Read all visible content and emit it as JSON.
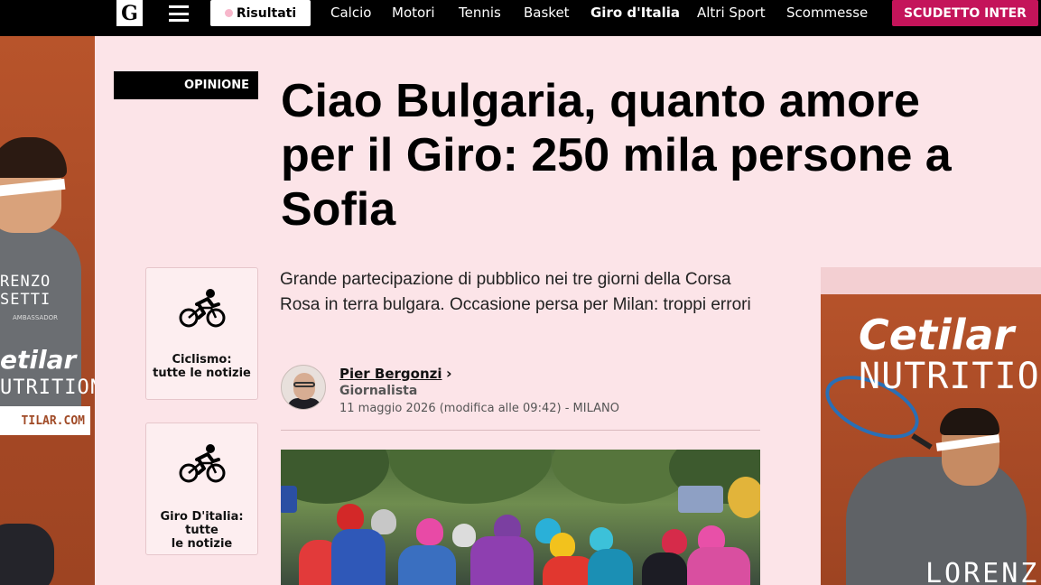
{
  "nav": {
    "logo": "G",
    "risultati_label": "Risultati",
    "links": [
      "Calcio",
      "Motori",
      "Tennis",
      "Basket",
      "Giro d'Italia",
      "Altri Sport",
      "Scommesse"
    ],
    "highlight_label": "SCUDETTO INTER",
    "highlight_color": "#c4145a"
  },
  "ads": {
    "left": {
      "line1": "RENZO",
      "line2": "SETTI",
      "line3": "AMBASSADOR",
      "brand": "etilar",
      "sub": "UTRITION",
      "url": "TILAR.COM"
    },
    "right": {
      "brand": "Cetilar",
      "sub": "NUTRITION",
      "name": "LORENZ"
    }
  },
  "article": {
    "category": "OPINIONE",
    "headline": "Ciao Bulgaria, quanto amore per il Giro: 250 mila persone a Sofia",
    "summary": "Grande partecipazione di pubblico nei tre giorni della Corsa Rosa in terra bulgara. Occasione persa per Milan: troppi errori",
    "author": {
      "name": "Pier Bergonzi",
      "role": "Giornalista",
      "date": "11 maggio 2026 (modifica alle 09:42) - MILANO"
    }
  },
  "sidebar": {
    "cards": [
      {
        "label_line1": "Ciclismo:",
        "label_line2": "tutte le notizie",
        "icon": "cyclist-icon"
      },
      {
        "label_line1": "Giro D'italia:",
        "label_line2": "tutte",
        "label_line3": "le notizie",
        "icon": "cyclist-icon"
      }
    ]
  },
  "colors": {
    "page_bg": "#fce4e8",
    "nav_bg": "#000000",
    "accent": "#c4145a"
  }
}
